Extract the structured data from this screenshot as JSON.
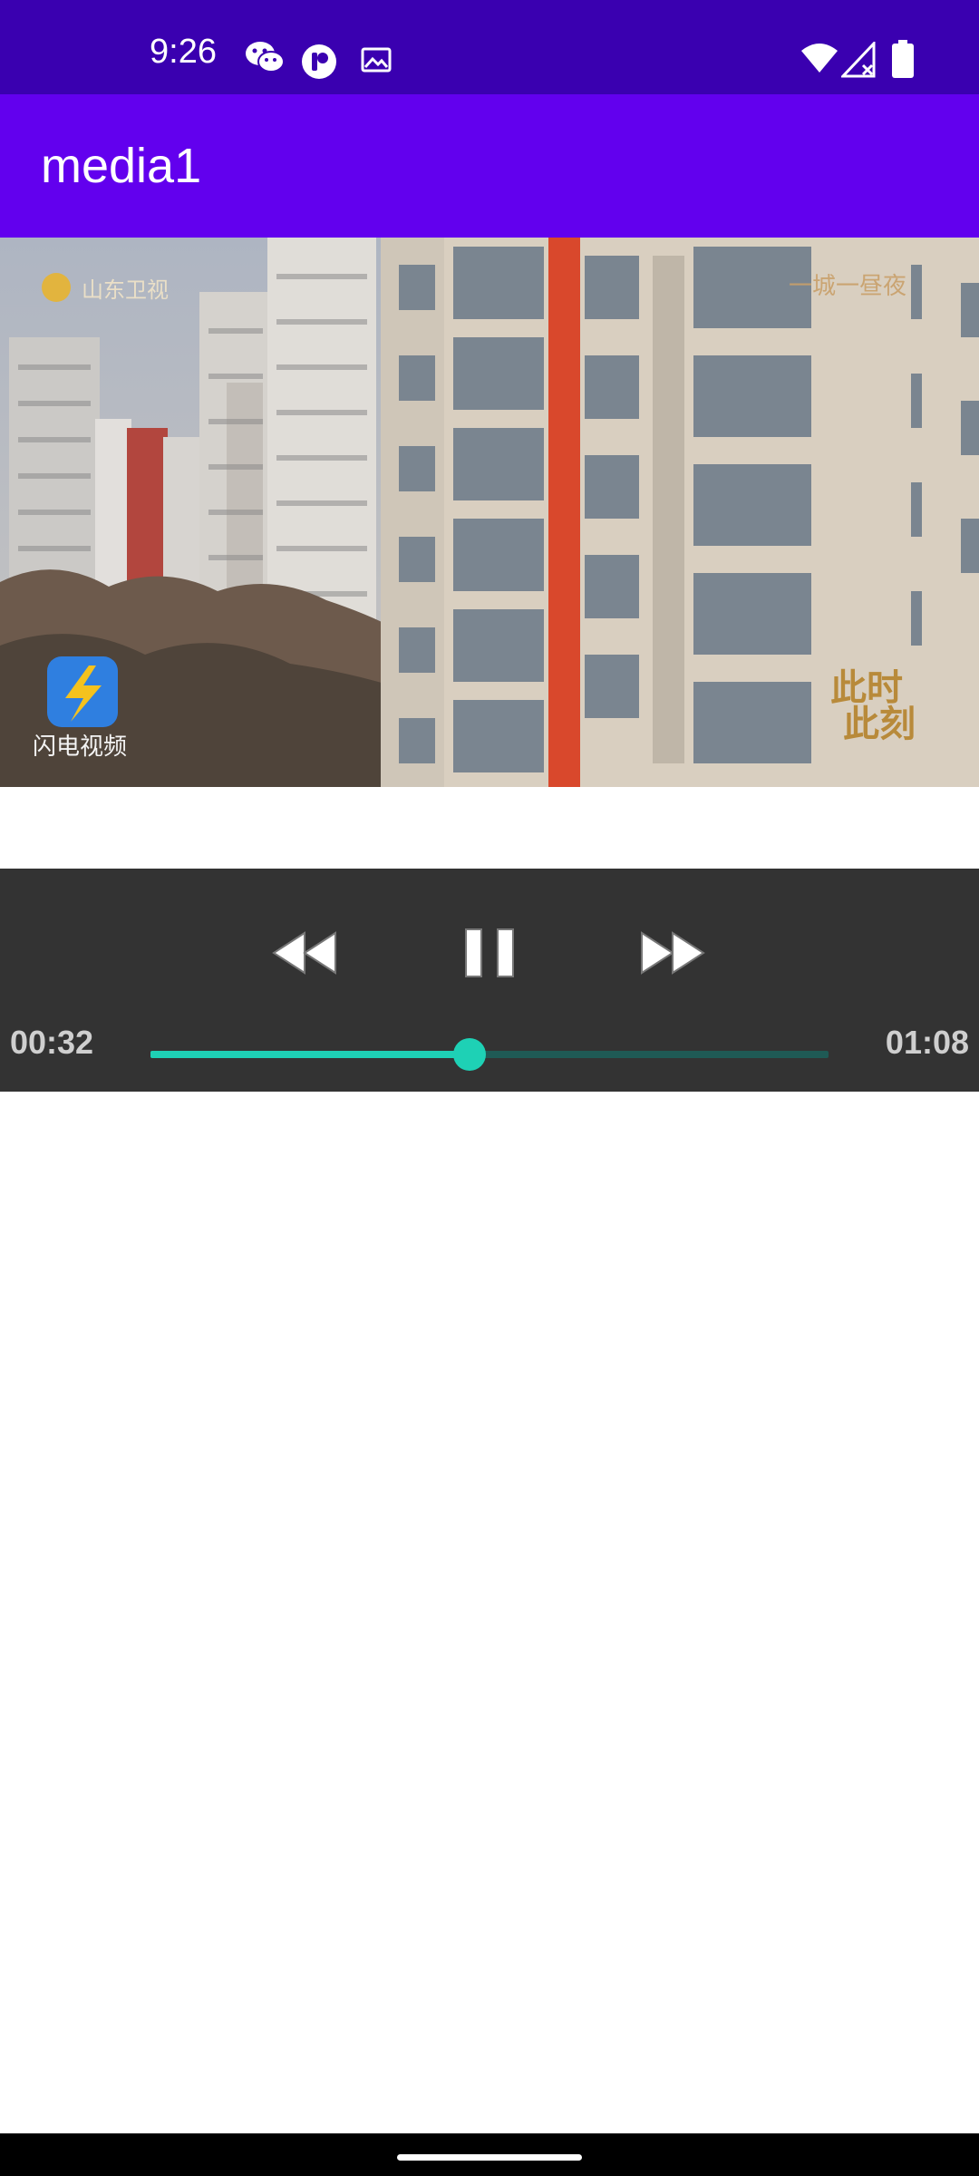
{
  "status_bar": {
    "time": "9:26",
    "icons": [
      "wechat-icon",
      "app-notification-icon",
      "image-icon",
      "wifi-icon",
      "signal-icon",
      "battery-icon"
    ]
  },
  "app_bar": {
    "title": "media1"
  },
  "video": {
    "watermarks": {
      "channel_logo": "山东卫视",
      "top_right": "一城一昼夜",
      "app_logo": "闪电视频",
      "program_logo": "此时此刻"
    }
  },
  "player": {
    "current_time": "00:32",
    "total_time": "01:08",
    "progress": 0.47,
    "icons": {
      "rewind": "rewind-icon",
      "pause": "pause-icon",
      "forward": "fast-forward-icon"
    }
  },
  "colors": {
    "status_bar": "#3a00b0",
    "app_bar": "#6200ee",
    "controls_bg": "#333333",
    "accent": "#1ed1b5"
  }
}
